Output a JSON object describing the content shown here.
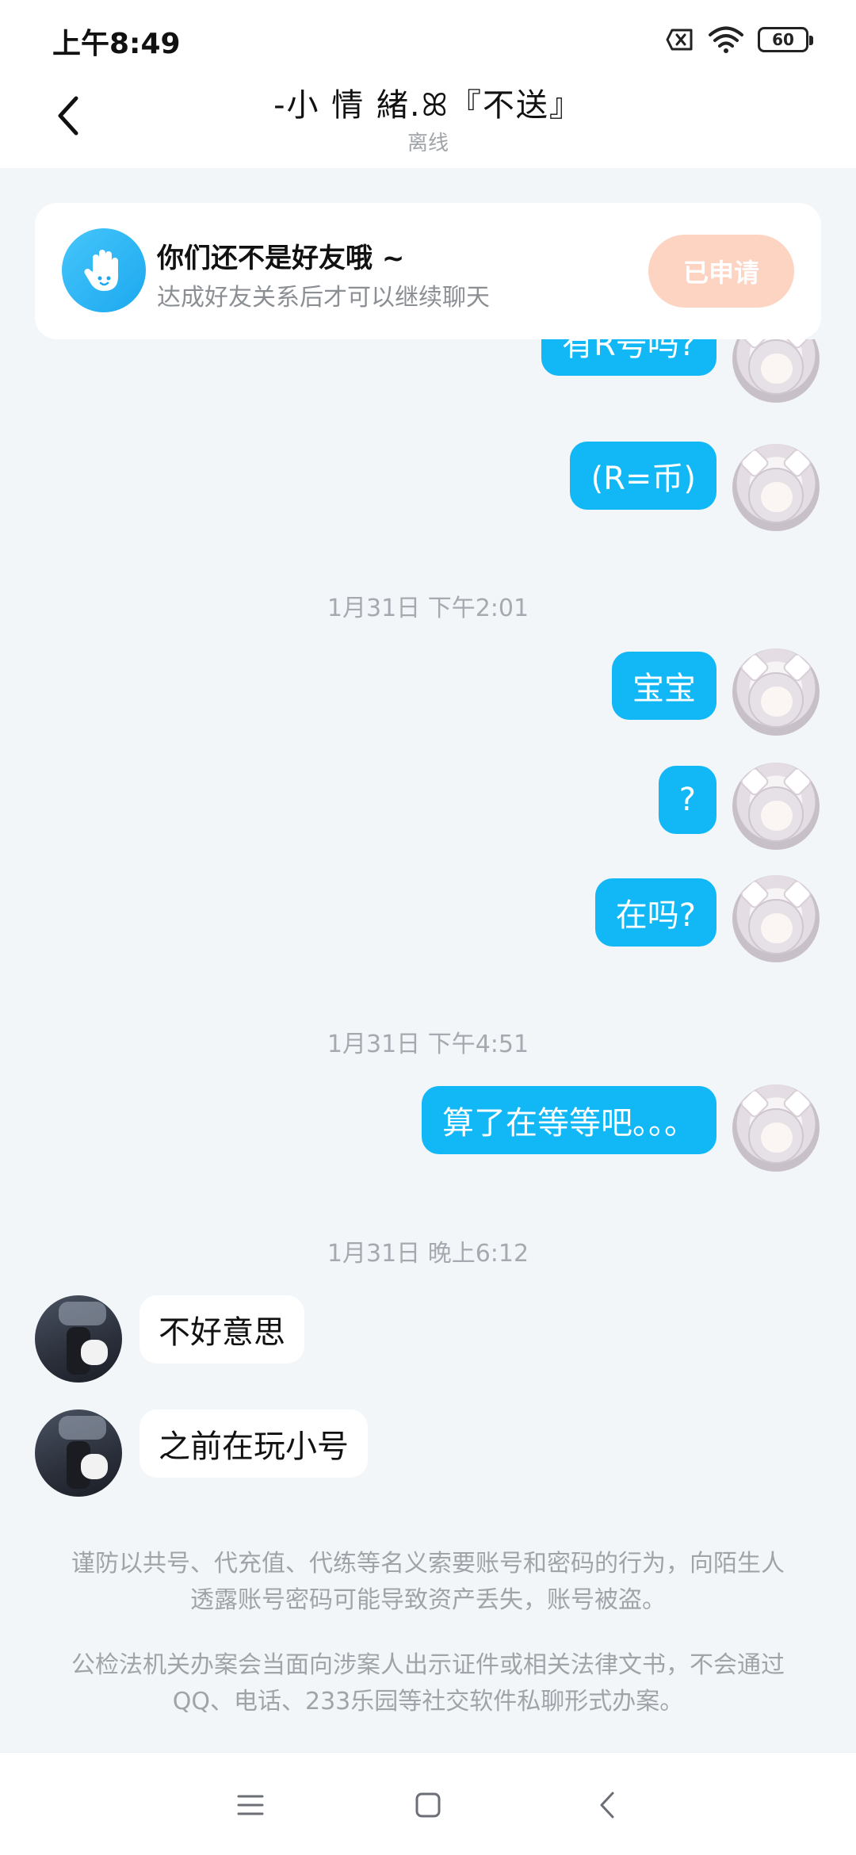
{
  "status_bar": {
    "time": "上午8:49",
    "battery": "60"
  },
  "header": {
    "title": "-小 情 緒.ꕤ『不送』",
    "subtitle": "离线"
  },
  "friend_banner": {
    "title": "你们还不是好友哦 ~",
    "description": "达成好友关系后才可以继续聊天",
    "button_label": "已申请",
    "button_color": "#fdd4c2"
  },
  "messages": {
    "partial_top": "有R号吗?",
    "m1": "(R=币)",
    "ts1": "1月31日 下午2:01",
    "m2": "宝宝",
    "m3": "?",
    "m4": "在吗?",
    "ts2": "1月31日 下午4:51",
    "m5": "算了在等等吧。。。",
    "ts3": "1月31日 晚上6:12",
    "r1": "不好意思",
    "r2": "之前在玩小号"
  },
  "notices": {
    "n1": "谨防以共号、代充值、代练等名义索要账号和密码的行为，向陌生人透露账号密码可能导致资产丢失，账号被盗。",
    "n2": "公检法机关办案会当面向涉案人出示证件或相关法律文书，不会通过QQ、电话、233乐园等社交软件私聊形式办案。"
  },
  "colors": {
    "accent": "#12b7f5",
    "background": "#f3f6f9"
  },
  "icons": {
    "back": "chevron-left-icon",
    "wave": "hand-wave-icon",
    "menu": "menu-icon",
    "home": "home-square-icon",
    "nav_back": "nav-back-icon"
  }
}
